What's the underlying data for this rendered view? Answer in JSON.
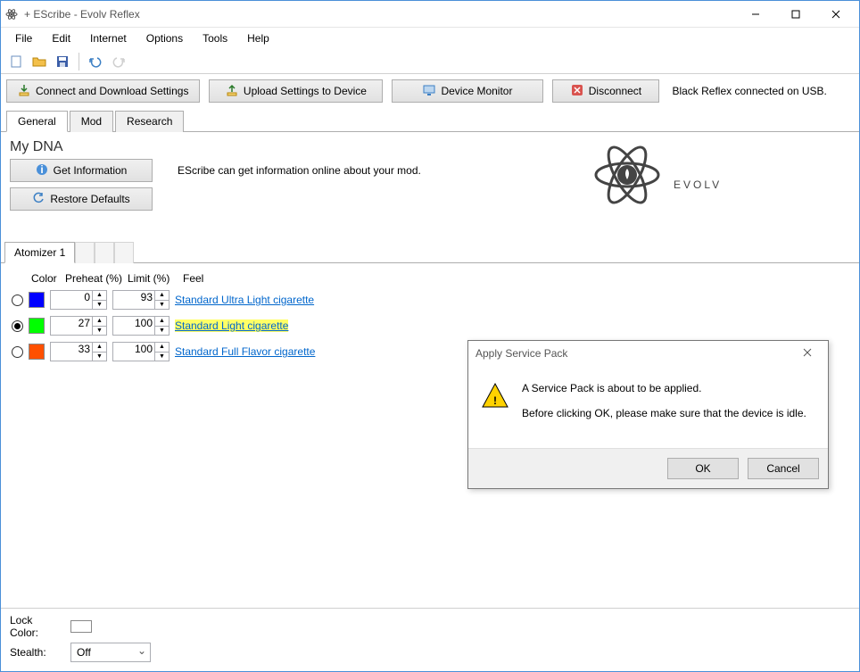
{
  "window": {
    "title": "+ EScribe - Evolv Reflex"
  },
  "menu": {
    "file": "File",
    "edit": "Edit",
    "internet": "Internet",
    "options": "Options",
    "tools": "Tools",
    "help": "Help"
  },
  "actions": {
    "connect": "Connect and Download Settings",
    "upload": "Upload Settings to Device",
    "monitor": "Device Monitor",
    "disconnect": "Disconnect",
    "status": "Black Reflex connected on USB."
  },
  "tabs": {
    "general": "General",
    "mod": "Mod",
    "research": "Research"
  },
  "dna": {
    "heading": "My DNA",
    "get_info": "Get Information",
    "info_text": "EScribe can get information online about your mod.",
    "restore": "Restore Defaults"
  },
  "brand": "EVOLV",
  "atomizer": {
    "tab": "Atomizer 1",
    "headers": {
      "color": "Color",
      "preheat": "Preheat (%)",
      "limit": "Limit (%)",
      "feel": "Feel"
    },
    "rows": [
      {
        "selected": false,
        "color": "#0000ff",
        "preheat": "0",
        "limit": "93",
        "feel": "Standard Ultra Light cigarette",
        "highlight": false
      },
      {
        "selected": true,
        "color": "#00ff00",
        "preheat": "27",
        "limit": "100",
        "feel": "Standard Light cigarette",
        "highlight": true
      },
      {
        "selected": false,
        "color": "#ff5000",
        "preheat": "33",
        "limit": "100",
        "feel": "Standard Full Flavor cigarette",
        "highlight": false
      }
    ]
  },
  "bottom": {
    "lock_label": "Lock Color:",
    "stealth_label": "Stealth:",
    "stealth_value": "Off"
  },
  "dialog": {
    "title": "Apply Service Pack",
    "line1": "A Service Pack is about to be applied.",
    "line2": "Before clicking OK, please make sure that the device is idle.",
    "ok": "OK",
    "cancel": "Cancel"
  }
}
